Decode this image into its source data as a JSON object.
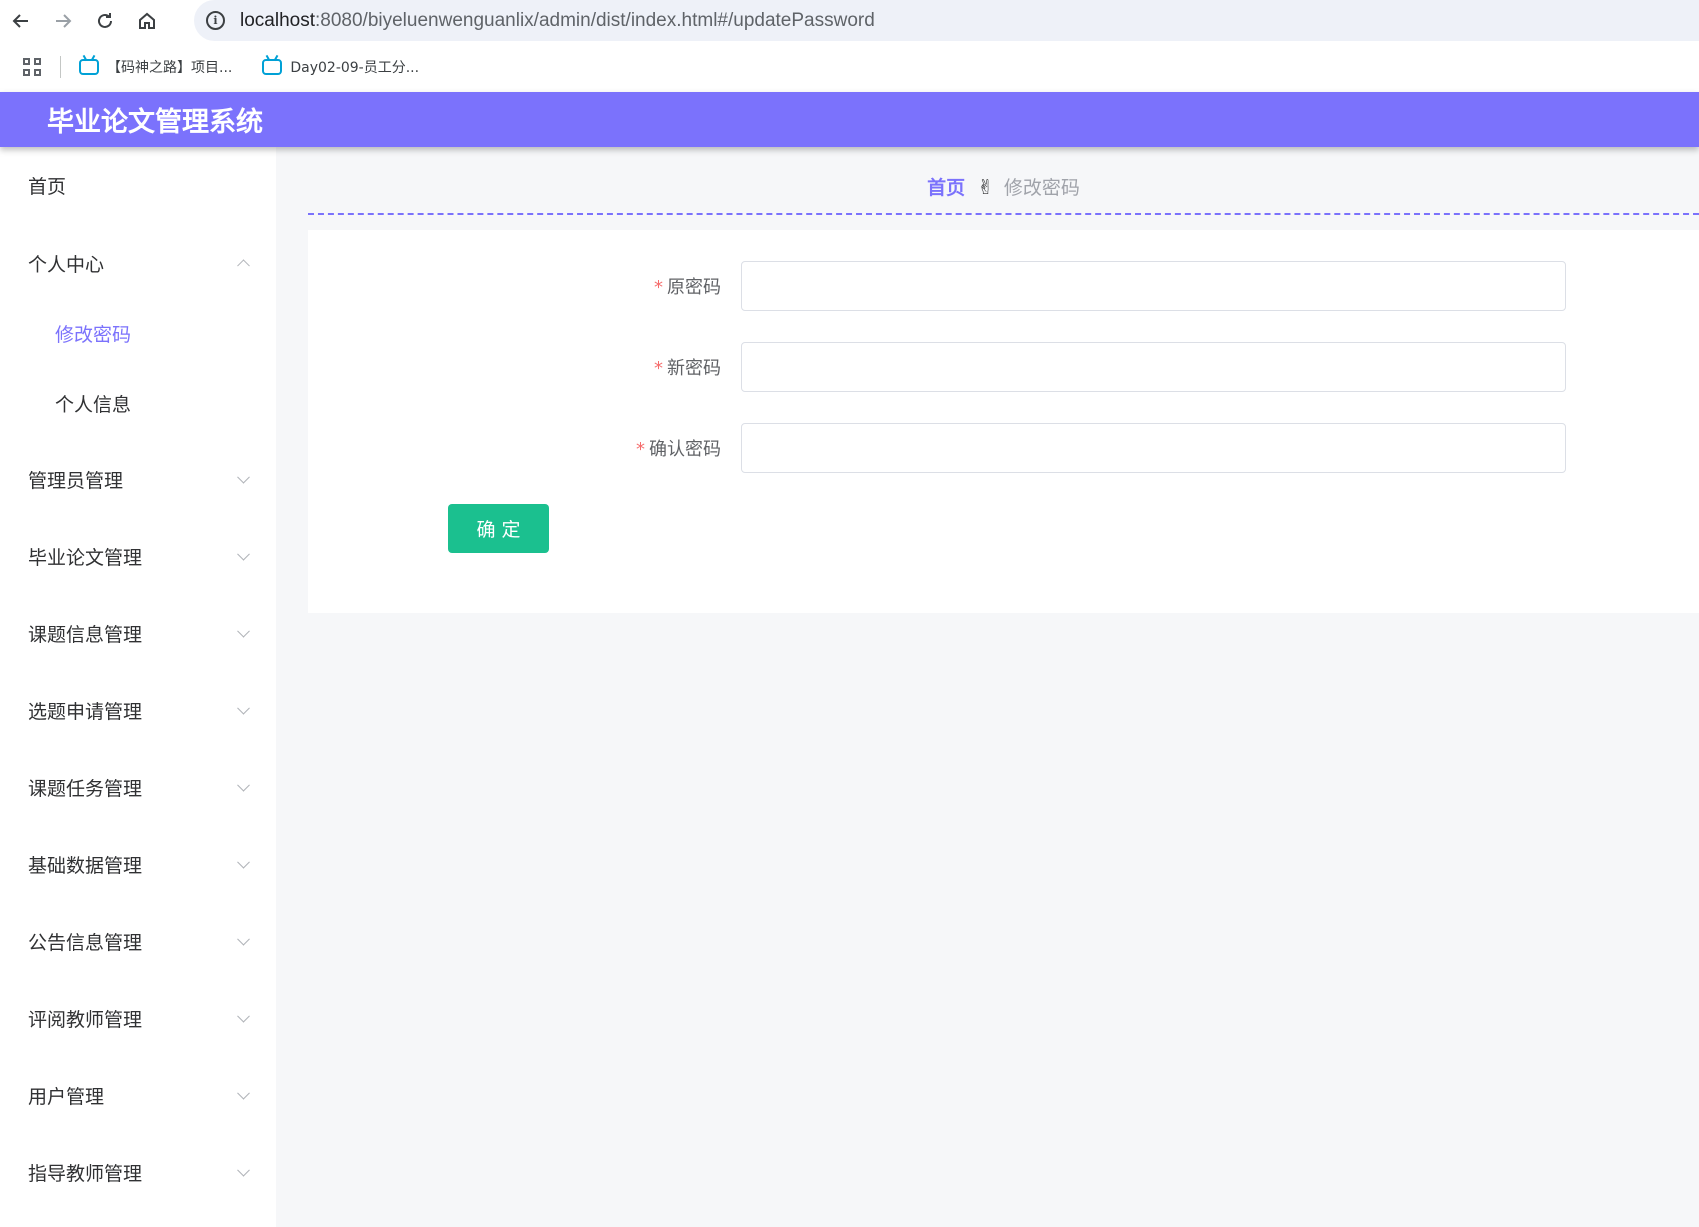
{
  "browser": {
    "url_host": "localhost",
    "url_path": ":8080/biyeluenwenguanlix/admin/dist/index.html#/updatePassword",
    "bookmarks": [
      {
        "label": "【码神之路】项目..."
      },
      {
        "label": "Day02-09-员工分..."
      }
    ]
  },
  "app": {
    "title": "毕业论文管理系统"
  },
  "sidebar": {
    "home": "首页",
    "personal_center": "个人中心",
    "change_password": "修改密码",
    "personal_info": "个人信息",
    "items": [
      {
        "label": "管理员管理"
      },
      {
        "label": "毕业论文管理"
      },
      {
        "label": "课题信息管理"
      },
      {
        "label": "选题申请管理"
      },
      {
        "label": "课题任务管理"
      },
      {
        "label": "基础数据管理"
      },
      {
        "label": "公告信息管理"
      },
      {
        "label": "评阅教师管理"
      },
      {
        "label": "用户管理"
      },
      {
        "label": "指导教师管理"
      }
    ]
  },
  "breadcrumb": {
    "home": "首页",
    "separator": "✌",
    "current": "修改密码"
  },
  "form": {
    "required_mark": "*",
    "old_password_label": "原密码",
    "new_password_label": "新密码",
    "confirm_password_label": "确认密码",
    "old_password_value": "",
    "new_password_value": "",
    "confirm_password_value": "",
    "submit_label": "确定"
  },
  "colors": {
    "accent": "#7b72fc",
    "submit": "#1bc08f",
    "required": "#f56c6c"
  }
}
